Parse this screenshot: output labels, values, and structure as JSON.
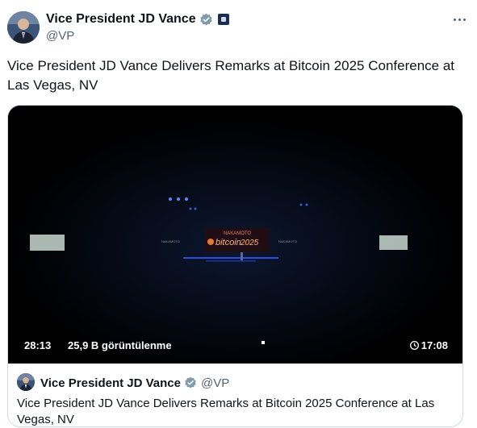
{
  "author": {
    "display_name": "Vice President JD Vance",
    "handle": "@VP",
    "verified_color": "#829aab"
  },
  "tweet": {
    "text": "Vice President JD Vance Delivers Remarks at Bitcoin 2025 Conference at Las Vegas, NV"
  },
  "video": {
    "duration": "28:13",
    "views": "25,9 B görüntülenme",
    "scheduled_time": "17:08",
    "screen_brand_top": "NAKAMOTO",
    "screen_brand_main": "bitcoin",
    "screen_brand_year": "2025",
    "side_label_left": "NAKAMOTO",
    "side_label_right": "NAKAMOTO"
  },
  "quoted": {
    "display_name": "Vice President JD Vance",
    "handle": "@VP",
    "text": "Vice President JD Vance Delivers Remarks at Bitcoin 2025 Conference at Las Vegas, NV"
  }
}
